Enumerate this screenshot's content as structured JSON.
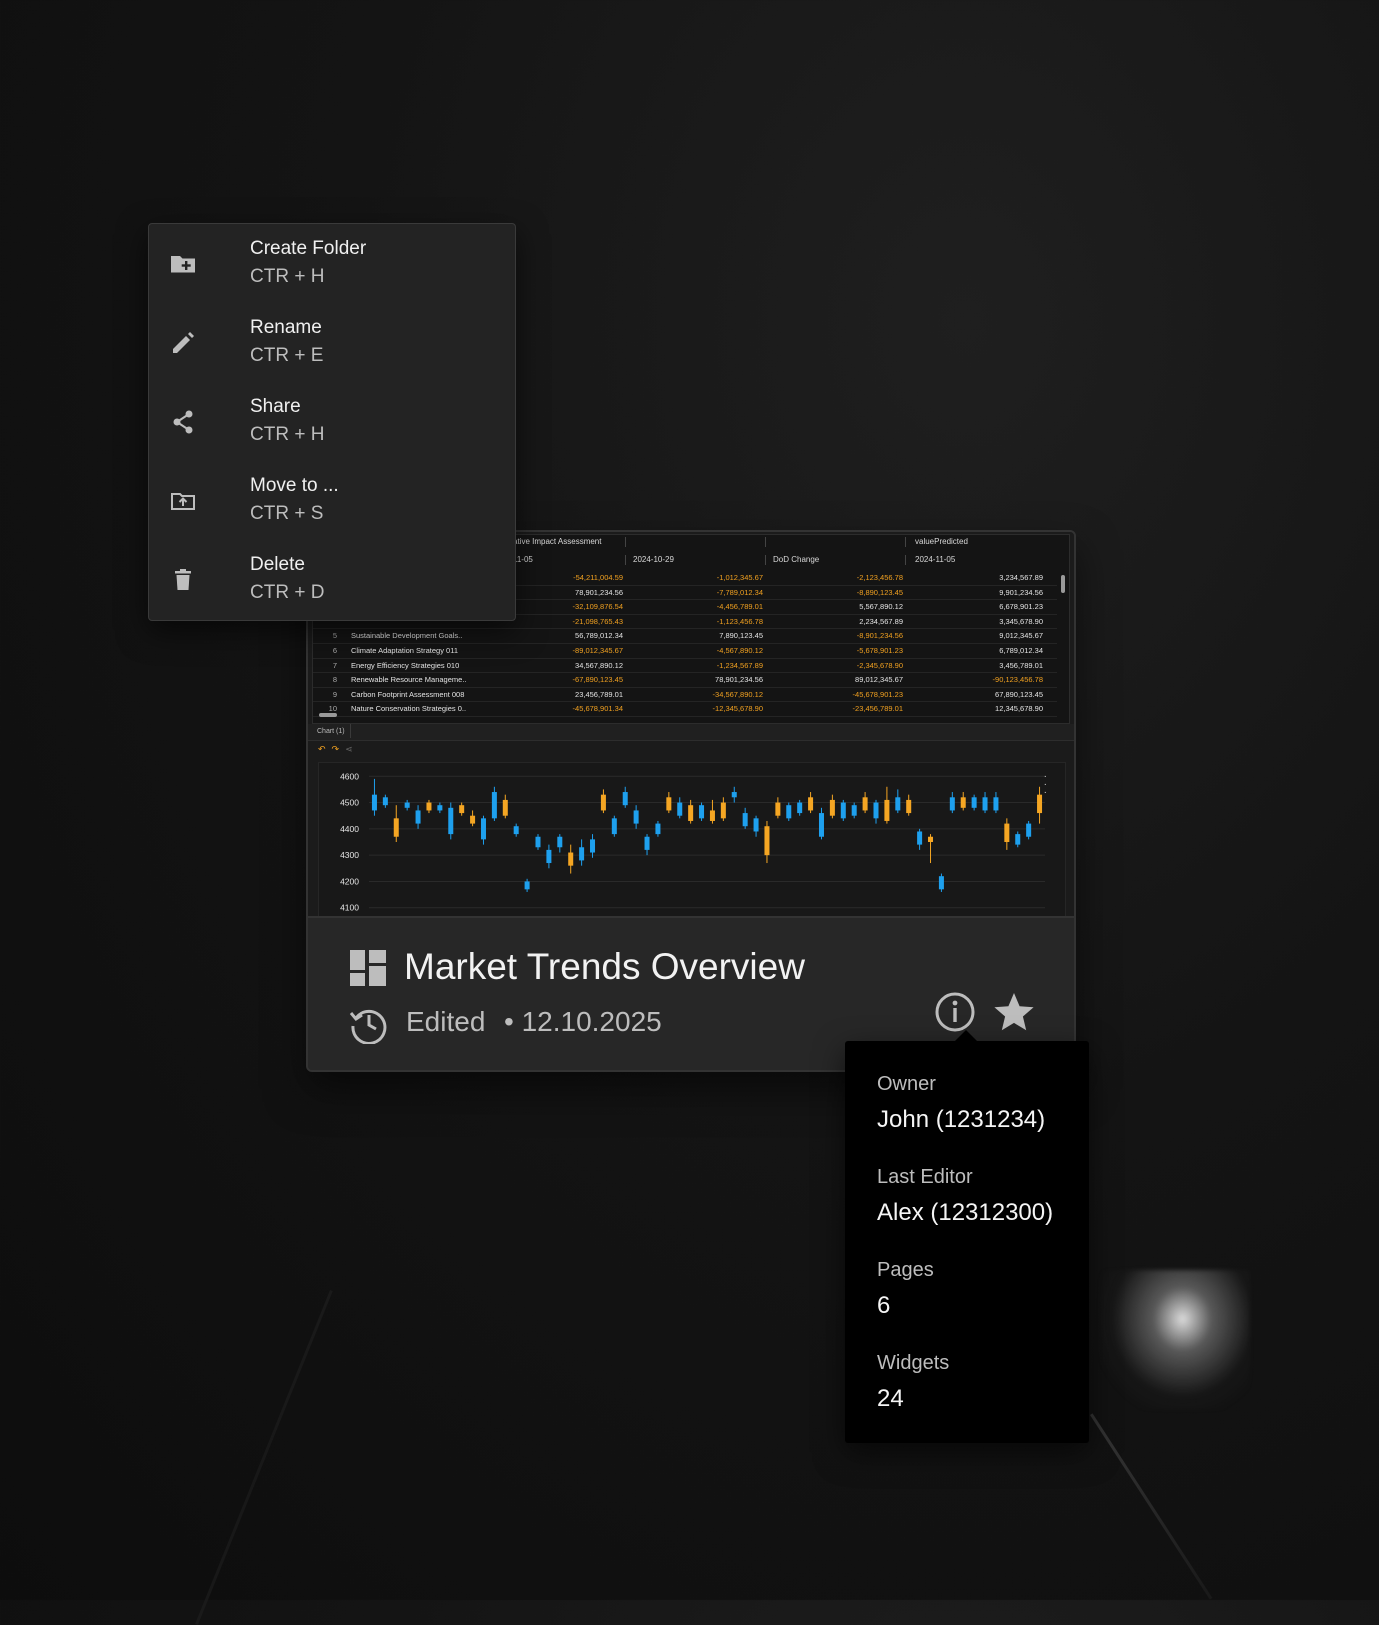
{
  "context_menu": {
    "items": [
      {
        "label": "Create Folder",
        "shortcut": "CTR + H",
        "icon": "create-folder-icon"
      },
      {
        "label": "Rename",
        "shortcut": "CTR + E",
        "icon": "pencil-icon"
      },
      {
        "label": "Share",
        "shortcut": "CTR + H",
        "icon": "share-icon"
      },
      {
        "label": "Move to ...",
        "shortcut": "CTR + S",
        "icon": "move-folder-icon"
      },
      {
        "label": "Delete",
        "shortcut": "CTR + D",
        "icon": "trash-icon"
      }
    ]
  },
  "dashboard": {
    "title": "Market Trends Overview",
    "edited_label": "Edited",
    "edited_date": "• 12.10.2025",
    "icon": "dashboard-icon",
    "info_icon": "info-icon",
    "star_icon": "star-icon"
  },
  "preview_table": {
    "headers": {
      "group1": "ative Impact Assessment",
      "group2": "valuePredicted",
      "col1": "11-05",
      "col2": "2024-10-29",
      "col3": "DoD Change",
      "col4": "2024-11-05"
    },
    "rows": [
      {
        "idx": "",
        "name": "",
        "v1": "-54,211,004.59",
        "v2": "-1,012,345.67",
        "v3": "-2,123,456.78",
        "v4": "3,234,567.89"
      },
      {
        "idx": "",
        "name": "",
        "v1": "78,901,234.56",
        "v2": "-7,789,012.34",
        "v3": "-8,890,123.45",
        "v4": "9,901,234.56"
      },
      {
        "idx": "",
        "name": "",
        "v1": "-32,109,876.54",
        "v2": "-4,456,789.01",
        "v3": "5,567,890.12",
        "v4": "6,678,901.23"
      },
      {
        "idx": "",
        "name": "",
        "v1": "-21,098,765.43",
        "v2": "-1,123,456.78",
        "v3": "2,234,567.89",
        "v4": "3,345,678.90"
      },
      {
        "idx": "5",
        "name": "Sustainable Development Goals..",
        "v1": "56,789,012.34",
        "v2": "7,890,123.45",
        "v3": "-8,901,234.56",
        "v4": "9,012,345.67"
      },
      {
        "idx": "6",
        "name": "Climate Adaptation Strategy 011",
        "v1": "-89,012,345.67",
        "v2": "-4,567,890.12",
        "v3": "-5,678,901.23",
        "v4": "6,789,012.34"
      },
      {
        "idx": "7",
        "name": "Energy Efficiency Strategies 010",
        "v1": "34,567,890.12",
        "v2": "-1,234,567.89",
        "v3": "-2,345,678.90",
        "v4": "3,456,789.01"
      },
      {
        "idx": "8",
        "name": "Renewable Resource Manageme..",
        "v1": "-67,890,123.45",
        "v2": "78,901,234.56",
        "v3": "89,012,345.67",
        "v4": "-90,123,456.78"
      },
      {
        "idx": "9",
        "name": "Carbon Footprint Assessment 008",
        "v1": "23,456,789.01",
        "v2": "-34,567,890.12",
        "v3": "-45,678,901.23",
        "v4": "67,890,123.45"
      },
      {
        "idx": "10",
        "name": "Nature Conservation Strategies 0..",
        "v1": "-45,678,901.34",
        "v2": "-12,345,678.90",
        "v3": "-23,456,789.01",
        "v4": "12,345,678.90"
      }
    ]
  },
  "chart_tab": {
    "label": "Chart (1)"
  },
  "chart_data": {
    "type": "candlestick",
    "title": "",
    "xlabel": "",
    "ylabel": "",
    "ylim": [
      4080,
      4620
    ],
    "y_ticks": [
      4600,
      4500,
      4400,
      4300,
      4200,
      4100
    ],
    "colors": {
      "up": "#1ea0ee",
      "down": "#f5a623"
    },
    "candles": [
      {
        "o": 4470,
        "c": 4530,
        "h": 4590,
        "l": 4450
      },
      {
        "o": 4490,
        "c": 4520,
        "h": 4530,
        "l": 4480
      },
      {
        "o": 4440,
        "c": 4370,
        "h": 4490,
        "l": 4350
      },
      {
        "o": 4480,
        "c": 4500,
        "h": 4510,
        "l": 4470
      },
      {
        "o": 4420,
        "c": 4470,
        "h": 4490,
        "l": 4400
      },
      {
        "o": 4500,
        "c": 4470,
        "h": 4510,
        "l": 4460
      },
      {
        "o": 4470,
        "c": 4490,
        "h": 4500,
        "l": 4460
      },
      {
        "o": 4380,
        "c": 4480,
        "h": 4500,
        "l": 4360
      },
      {
        "o": 4490,
        "c": 4460,
        "h": 4500,
        "l": 4450
      },
      {
        "o": 4450,
        "c": 4420,
        "h": 4470,
        "l": 4410
      },
      {
        "o": 4360,
        "c": 4440,
        "h": 4450,
        "l": 4340
      },
      {
        "o": 4440,
        "c": 4540,
        "h": 4560,
        "l": 4430
      },
      {
        "o": 4510,
        "c": 4450,
        "h": 4530,
        "l": 4440
      },
      {
        "o": 4380,
        "c": 4410,
        "h": 4420,
        "l": 4370
      },
      {
        "o": 4170,
        "c": 4200,
        "h": 4210,
        "l": 4160
      },
      {
        "o": 4330,
        "c": 4370,
        "h": 4380,
        "l": 4320
      },
      {
        "o": 4270,
        "c": 4320,
        "h": 4340,
        "l": 4250
      },
      {
        "o": 4330,
        "c": 4370,
        "h": 4380,
        "l": 4310
      },
      {
        "o": 4310,
        "c": 4260,
        "h": 4340,
        "l": 4230
      },
      {
        "o": 4280,
        "c": 4330,
        "h": 4360,
        "l": 4260
      },
      {
        "o": 4310,
        "c": 4360,
        "h": 4380,
        "l": 4290
      },
      {
        "o": 4530,
        "c": 4470,
        "h": 4550,
        "l": 4460
      },
      {
        "o": 4380,
        "c": 4440,
        "h": 4450,
        "l": 4370
      },
      {
        "o": 4490,
        "c": 4540,
        "h": 4560,
        "l": 4480
      },
      {
        "o": 4420,
        "c": 4470,
        "h": 4490,
        "l": 4400
      },
      {
        "o": 4320,
        "c": 4370,
        "h": 4380,
        "l": 4300
      },
      {
        "o": 4380,
        "c": 4420,
        "h": 4430,
        "l": 4370
      },
      {
        "o": 4520,
        "c": 4470,
        "h": 4540,
        "l": 4460
      },
      {
        "o": 4450,
        "c": 4500,
        "h": 4520,
        "l": 4440
      },
      {
        "o": 4490,
        "c": 4430,
        "h": 4510,
        "l": 4420
      },
      {
        "o": 4440,
        "c": 4490,
        "h": 4500,
        "l": 4430
      },
      {
        "o": 4470,
        "c": 4430,
        "h": 4510,
        "l": 4420
      },
      {
        "o": 4500,
        "c": 4440,
        "h": 4520,
        "l": 4430
      },
      {
        "o": 4520,
        "c": 4540,
        "h": 4560,
        "l": 4500
      },
      {
        "o": 4410,
        "c": 4460,
        "h": 4480,
        "l": 4400
      },
      {
        "o": 4390,
        "c": 4440,
        "h": 4450,
        "l": 4370
      },
      {
        "o": 4410,
        "c": 4300,
        "h": 4430,
        "l": 4270
      },
      {
        "o": 4500,
        "c": 4450,
        "h": 4520,
        "l": 4440
      },
      {
        "o": 4440,
        "c": 4490,
        "h": 4500,
        "l": 4430
      },
      {
        "o": 4460,
        "c": 4500,
        "h": 4510,
        "l": 4450
      },
      {
        "o": 4520,
        "c": 4470,
        "h": 4540,
        "l": 4460
      },
      {
        "o": 4370,
        "c": 4460,
        "h": 4480,
        "l": 4360
      },
      {
        "o": 4510,
        "c": 4450,
        "h": 4530,
        "l": 4440
      },
      {
        "o": 4440,
        "c": 4500,
        "h": 4510,
        "l": 4430
      },
      {
        "o": 4450,
        "c": 4490,
        "h": 4500,
        "l": 4440
      },
      {
        "o": 4520,
        "c": 4470,
        "h": 4540,
        "l": 4460
      },
      {
        "o": 4440,
        "c": 4500,
        "h": 4510,
        "l": 4420
      },
      {
        "o": 4510,
        "c": 4430,
        "h": 4560,
        "l": 4420
      },
      {
        "o": 4470,
        "c": 4520,
        "h": 4550,
        "l": 4460
      },
      {
        "o": 4510,
        "c": 4460,
        "h": 4530,
        "l": 4450
      },
      {
        "o": 4340,
        "c": 4390,
        "h": 4400,
        "l": 4320
      },
      {
        "o": 4370,
        "c": 4350,
        "h": 4380,
        "l": 4270
      },
      {
        "o": 4170,
        "c": 4220,
        "h": 4230,
        "l": 4160
      },
      {
        "o": 4470,
        "c": 4520,
        "h": 4540,
        "l": 4460
      },
      {
        "o": 4520,
        "c": 4480,
        "h": 4540,
        "l": 4470
      },
      {
        "o": 4480,
        "c": 4520,
        "h": 4530,
        "l": 4470
      },
      {
        "o": 4470,
        "c": 4520,
        "h": 4540,
        "l": 4460
      },
      {
        "o": 4470,
        "c": 4520,
        "h": 4540,
        "l": 4460
      },
      {
        "o": 4420,
        "c": 4350,
        "h": 4440,
        "l": 4320
      },
      {
        "o": 4340,
        "c": 4380,
        "h": 4390,
        "l": 4330
      },
      {
        "o": 4370,
        "c": 4420,
        "h": 4430,
        "l": 4360
      },
      {
        "o": 4530,
        "c": 4460,
        "h": 4560,
        "l": 4420
      }
    ]
  },
  "info_tooltip": {
    "owner_label": "Owner",
    "owner_value": "John (1231234)",
    "editor_label": "Last Editor",
    "editor_value": "Alex (12312300)",
    "pages_label": "Pages",
    "pages_value": "6",
    "widgets_label": "Widgets",
    "widgets_value": "24"
  }
}
